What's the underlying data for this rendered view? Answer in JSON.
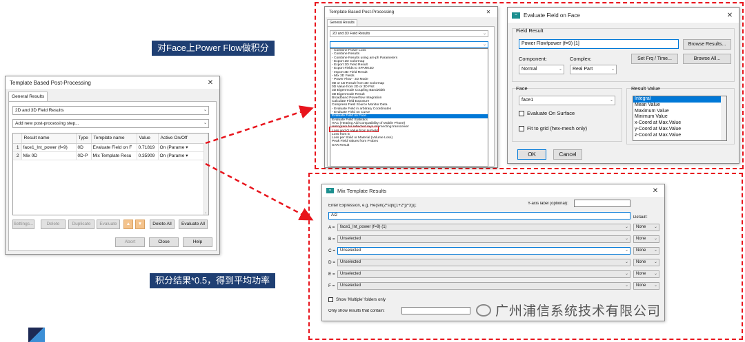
{
  "left_window": {
    "title": "Template Based Post-Processing",
    "tab": "General Results",
    "combo1": "2D and 3D Field Results",
    "combo2": "Add new post-processing step...",
    "columns": [
      "Result name",
      "Type",
      "Template name",
      "Value",
      "Active On/Off"
    ],
    "rows": [
      {
        "num": "1",
        "name": "face1_Int_power (f=9)",
        "type": "0D",
        "template": "Evaluate Field on F",
        "value": "0.71819",
        "active": "On (Parame"
      },
      {
        "num": "2",
        "name": "Mix 0D",
        "type": "0D-P",
        "template": "Mix Template Resu",
        "value": "0.35909",
        "active": "On (Parame"
      }
    ],
    "buttons": {
      "settings": "Settings...",
      "delete": "Delete",
      "duplicate": "Duplicate",
      "evaluate": "Evaluate",
      "delete_all": "Delete All",
      "evaluate_all": "Evaluate All",
      "abort": "Abort",
      "close": "Close",
      "help": "Help"
    }
  },
  "mid_window": {
    "title": "Template Based Post-Processing",
    "tab": "General Results",
    "combo1": "2D and 3D Field Results",
    "combo2": "",
    "items": [
      "- Combine Power Loss",
      "- Combine Results",
      "- Combine Results using am-ph Parameters",
      "- Export 2D Colormap",
      "- Export 3D Field Result",
      "- Export Fields to SPARK3D",
      "- Import 3D Field Result",
      "- Mix 3D Fields",
      "- Power Flow - 3D Mode",
      "0D or 1D Result from 2D Colormap",
      "0D Value from 2D or 3D Plot",
      "3D Eigenmode Coupling Bandwidth",
      "3D Eigenmode Result",
      "Broadband Powerflow Integration",
      "Calculate Field Exposure",
      "Compress Field Source Monitor Data",
      "- Evaluate Field in arbitrary Coordinates",
      "- Evaluate Field on Curve",
      "Evaluate Field on Face",
      "Evaluate Field Statistics",
      "HAC (Hearing Aid Compatibility of Mobile Phone)",
      "Histogram for reflected rays intersecting transceiver",
      "Loss and Q Value from H-Field",
      "Loss from E",
      "Loss per Solid or Material (Volume Loss)",
      "Peak Field Values from Probes",
      "SAR Result"
    ],
    "selected_index": 18
  },
  "eval_dialog": {
    "title": "Evaluate Field on Face",
    "field_result_label": "Field Result",
    "field_result_value": "Power Flow\\power (f=9) [1]",
    "browse_results": "Browse Results...",
    "component_label": "Component:",
    "complex_label": "Complex:",
    "component_value": "Normal",
    "complex_value": "Real Part",
    "set_frq": "Set Frq / Time...",
    "browse_all": "Browse All...",
    "face_label": "Face",
    "face_value": "face1",
    "eval_on_surface": "Evaluate On Surface",
    "fit_to_grid": "Fit to grid (hex-mesh only)",
    "result_value_label": "Result Value",
    "result_values": [
      "Integral",
      "Mean Value",
      "Maximum Value",
      "Minimum Value",
      "x-Coord at Max.Value",
      "y-Coord at Max.Value",
      "z-Coord at Max.Value"
    ],
    "ok": "OK",
    "cancel": "Cancel"
  },
  "mix_dialog": {
    "title": "Mix Template Results",
    "expr_label": "Enter Expression, e.g. Re(sin(2*sqr((1+2*j)^3)));",
    "yaxis_label": "Y-axis label (optional):",
    "expr_value": "A/2",
    "default_label": "Default:",
    "rows": [
      {
        "letter": "A =",
        "value": "face1_Int_power (f=9) (1)",
        "def": "None"
      },
      {
        "letter": "B =",
        "value": "Unselected",
        "def": "None"
      },
      {
        "letter": "C =",
        "value": "Unselected",
        "def": "None"
      },
      {
        "letter": "D =",
        "value": "Unselected",
        "def": "None"
      },
      {
        "letter": "E =",
        "value": "Unselected",
        "def": "None"
      },
      {
        "letter": "F =",
        "value": "Unselected",
        "def": "None"
      }
    ],
    "show_multiple": "Show 'Multiple' folders only",
    "only_show": "Only show results that contain:"
  },
  "annotations": {
    "label1": "对Face上Power Flow做积分",
    "label2": "积分结果*0.5，得到平均功率",
    "watermark": "广州浦信系统技术有限公司"
  },
  "colors": {
    "annotation_red": "#e8141c",
    "label_bg": "#1f3f73",
    "selection_blue": "#0078d7"
  }
}
